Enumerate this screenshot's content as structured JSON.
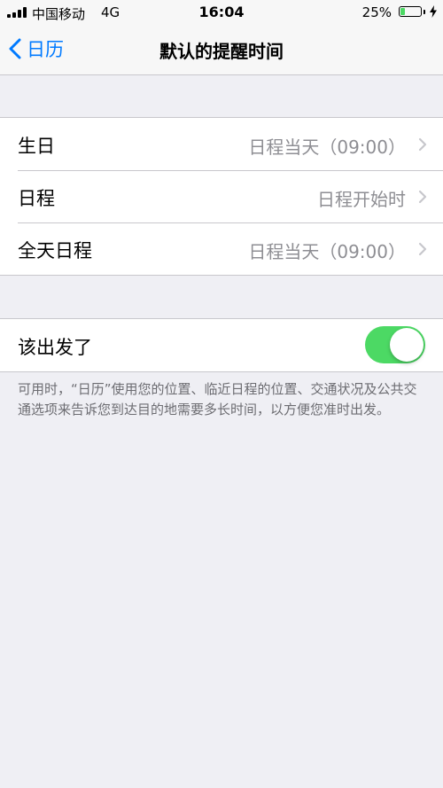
{
  "status_bar": {
    "carrier": "中国移动",
    "network": "4G",
    "time": "16:04",
    "battery_percent": "25%",
    "battery_level": 0.25
  },
  "nav": {
    "back_label": "日历",
    "title": "默认的提醒时间"
  },
  "reminders": [
    {
      "label": "生日",
      "value": "日程当天（09:00）"
    },
    {
      "label": "日程",
      "value": "日程开始时"
    },
    {
      "label": "全天日程",
      "value": "日程当天（09:00）"
    }
  ],
  "time_to_leave": {
    "label": "该出发了",
    "enabled": true
  },
  "footer_note": "可用时，“日历”使用您的位置、临近日程的位置、交通状况及公共交通选项来告诉您到达目的地需要多长时间，以方便您准时出发。",
  "colors": {
    "accent": "#007aff",
    "toggle_on": "#4cd964",
    "background": "#efeff4"
  }
}
